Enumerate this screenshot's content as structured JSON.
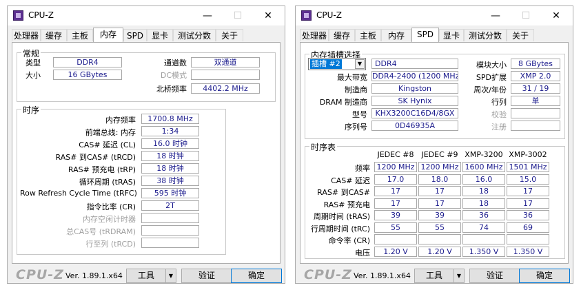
{
  "windows": [
    {
      "title": "CPU-Z",
      "tabs": [
        "处理器",
        "缓存",
        "主板",
        "内存",
        "SPD",
        "显卡",
        "测试分数",
        "关于"
      ],
      "active_tab": "内存",
      "general": {
        "title": "常规",
        "type_label": "类型",
        "type_value": "DDR4",
        "size_label": "大小",
        "size_value": "16 GBytes",
        "channels_label": "通道数",
        "channels_value": "双通道",
        "dc_label": "DC模式",
        "dc_value": "",
        "nb_label": "北桥频率",
        "nb_value": "4402.2 MHz"
      },
      "timings": {
        "title": "时序",
        "rows": [
          {
            "label": "内存频率",
            "value": "1700.8 MHz",
            "dim": false
          },
          {
            "label": "前端总线: 内存",
            "value": "1:34",
            "dim": false
          },
          {
            "label": "CAS# 延迟 (CL)",
            "value": "16.0 时钟",
            "dim": false
          },
          {
            "label": "RAS# 到CAS# (tRCD)",
            "value": "18 时钟",
            "dim": false
          },
          {
            "label": "RAS# 预充电 (tRP)",
            "value": "18 时钟",
            "dim": false
          },
          {
            "label": "循环周期 (tRAS)",
            "value": "38 时钟",
            "dim": false
          },
          {
            "label": "Row Refresh Cycle Time (tRFC)",
            "value": "595 时钟",
            "dim": false
          },
          {
            "label": "指令比率 (CR)",
            "value": "2T",
            "dim": false
          },
          {
            "label": "内存空闲计时器",
            "value": "",
            "dim": true
          },
          {
            "label": "总CAS号 (tRDRAM)",
            "value": "",
            "dim": true
          },
          {
            "label": "行至列 (tRCD)",
            "value": "",
            "dim": true
          }
        ]
      },
      "footer": {
        "logo": "CPU-Z",
        "version": "Ver. 1.89.1.x64",
        "tools": "工具",
        "validate": "验证",
        "ok": "确定"
      }
    },
    {
      "title": "CPU-Z",
      "tabs": [
        "处理器",
        "缓存",
        "主板",
        "内存",
        "SPD",
        "显卡",
        "测试分数",
        "关于"
      ],
      "active_tab": "SPD",
      "slot": {
        "title": "内存插槽选择",
        "slot_value": "插槽 #2",
        "type_value": "DDR4",
        "module_size_label": "模块大小",
        "module_size_value": "8 GBytes",
        "max_bw_label": "最大带宽",
        "max_bw_value": "DDR4-2400 (1200 MHz)",
        "spd_ext_label": "SPD扩展",
        "spd_ext_value": "XMP 2.0",
        "manufacturer_label": "制造商",
        "manufacturer_value": "Kingston",
        "week_year_label": "周次/年份",
        "week_year_value": "31 / 19",
        "dram_mfr_label": "DRAM 制造商",
        "dram_mfr_value": "SK Hynix",
        "ranks_label": "行列",
        "ranks_value": "单",
        "part_label": "型号",
        "part_value": "KHX3200C16D4/8GX",
        "check_label": "校验",
        "check_value": "",
        "serial_label": "序列号",
        "serial_value": "0D46935A",
        "reg_label": "注册",
        "reg_value": ""
      },
      "timing_table": {
        "title": "时序表",
        "columns": [
          "JEDEC #8",
          "JEDEC #9",
          "XMP-3200",
          "XMP-3002"
        ],
        "rows": [
          {
            "label": "频率",
            "values": [
              "1200 MHz",
              "1200 MHz",
              "1600 MHz",
              "1501 MHz"
            ]
          },
          {
            "label": "CAS# 延迟",
            "values": [
              "17.0",
              "18.0",
              "16.0",
              "15.0"
            ]
          },
          {
            "label": "RAS# 到CAS#",
            "values": [
              "17",
              "17",
              "18",
              "17"
            ]
          },
          {
            "label": "RAS# 预充电",
            "values": [
              "17",
              "17",
              "18",
              "17"
            ]
          },
          {
            "label": "周期时间 (tRAS)",
            "values": [
              "39",
              "39",
              "36",
              "36"
            ]
          },
          {
            "label": "行周期时间 (tRC)",
            "values": [
              "55",
              "55",
              "74",
              "69"
            ]
          },
          {
            "label": "命令率 (CR)",
            "values": [
              "",
              "",
              "",
              ""
            ]
          },
          {
            "label": "电压",
            "values": [
              "1.20 V",
              "1.20 V",
              "1.350 V",
              "1.350 V"
            ]
          }
        ]
      },
      "footer": {
        "logo": "CPU-Z",
        "version": "Ver. 1.89.1.x64",
        "tools": "工具",
        "validate": "验证",
        "ok": "确定"
      }
    }
  ]
}
